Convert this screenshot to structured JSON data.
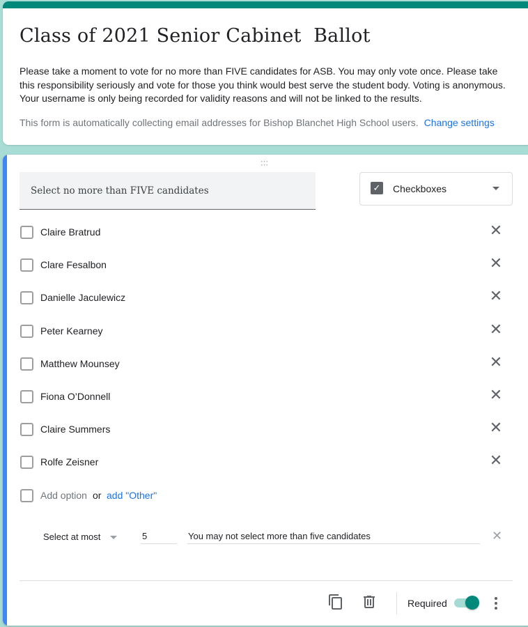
{
  "colors": {
    "theme": "#00897b",
    "background": "#a8ddd6",
    "active_bar": "#4285f4",
    "link": "#1a73e8"
  },
  "header": {
    "title": "Class of 2021 Senior Cabinet  Ballot",
    "description": "Please take a moment to vote for no more than FIVE candidates for ASB. You may only vote once. Please take this responsibility seriously and vote for those you think would best serve the student body. Voting is anonymous. Your username is only being recorded for validity reasons and will not be linked to the results.",
    "collect_note": "This form is automatically collecting email addresses for Bishop Blanchet High School users.",
    "change_settings_link": "Change settings"
  },
  "question": {
    "title": "Select no more than FIVE candidates",
    "type_label": "Checkboxes",
    "options": [
      {
        "label": "Claire Bratrud",
        "checked": false
      },
      {
        "label": "Clare Fesalbon",
        "checked": false
      },
      {
        "label": "Danielle Jaculewicz",
        "checked": false
      },
      {
        "label": "Peter Kearney",
        "checked": false
      },
      {
        "label": "Matthew Mounsey",
        "checked": false
      },
      {
        "label": "Fiona O’Donnell",
        "checked": false
      },
      {
        "label": "Claire Summers",
        "checked": false
      },
      {
        "label": "Rolfe Zeisner",
        "checked": false
      }
    ],
    "add_option_label": "Add option",
    "or_label": "or",
    "add_other_label": "add \"Other\"",
    "validation": {
      "rule": "Select at most",
      "value": "5",
      "error_text": "You may not select more than five candidates"
    },
    "footer": {
      "required_label": "Required",
      "required_on": true
    }
  }
}
